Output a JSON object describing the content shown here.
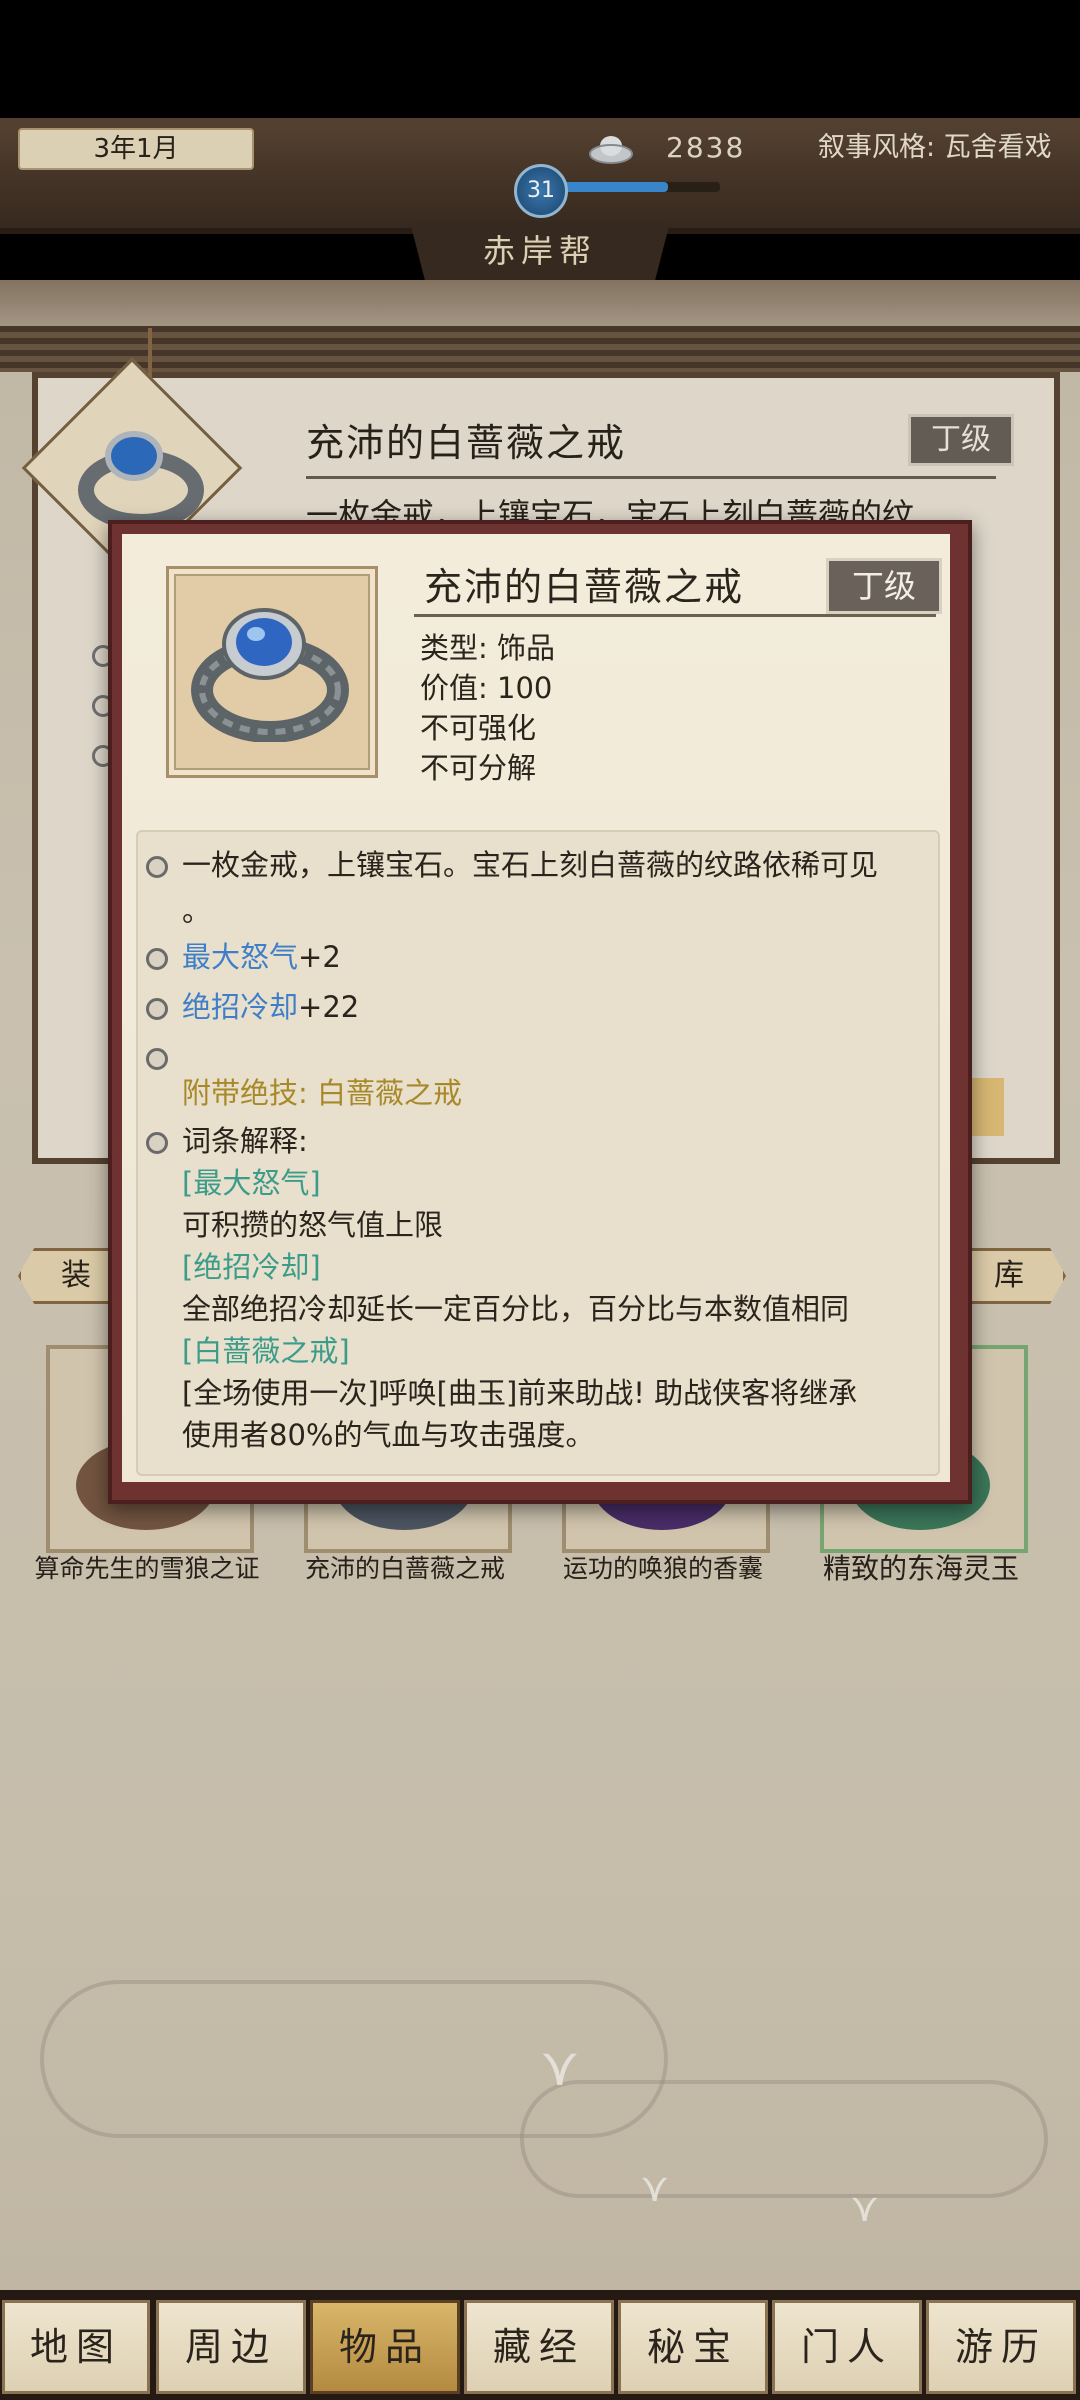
{
  "header": {
    "date": "3年1月",
    "money": "2838",
    "narrative_style": "叙事风格: 瓦舍看戏",
    "level": "31",
    "exp_fraction": 0.71,
    "sect_name": "赤岸帮"
  },
  "background_detail": {
    "title": "充沛的白蔷薇之戒",
    "grade": "丁级",
    "desc_partial": "一枚金戒，上镶宝石，宝石上刻白蔷薇的纹",
    "tab_left": "装",
    "tab_right": "库"
  },
  "items": [
    {
      "name": "算命先生的雪狼之证"
    },
    {
      "name": "充沛的白蔷薇之戒"
    },
    {
      "name": "运功的唤狼的香囊"
    },
    {
      "name": "精致的东海灵玉"
    }
  ],
  "modal": {
    "title": "充沛的白蔷薇之戒",
    "grade": "丁级",
    "type_line": "类型: 饰品",
    "value_line": "价值: 100",
    "enhance_line": "不可强化",
    "decompose_line": "不可分解",
    "description": "一枚金戒，上镶宝石。宝石上刻白蔷薇的纹路依稀可见",
    "description_tail": "。",
    "stat1_name": "最大怒气",
    "stat1_value": "+2",
    "stat2_name": "绝招冷却",
    "stat2_value": "+22",
    "skill_line": "附带绝技: 白蔷薇之戒",
    "terms_title": "词条解释:",
    "term1_name": "[最大怒气]",
    "term1_desc": "可积攒的怒气值上限",
    "term2_name": "[绝招冷却]",
    "term2_desc": "全部绝招冷却延长一定百分比，百分比与本数值相同",
    "term3_name": "[白蔷薇之戒]",
    "term3_desc_line1": "[全场使用一次]呼唤[曲玉]前来助战! 助战侠客将继承",
    "term3_desc_line2": "使用者80%的气血与攻击强度。"
  },
  "bottom_nav": [
    {
      "label": "地图"
    },
    {
      "label": "周边"
    },
    {
      "label": "物品",
      "active": true
    },
    {
      "label": "藏经"
    },
    {
      "label": "秘宝"
    },
    {
      "label": "门人"
    },
    {
      "label": "游历"
    }
  ],
  "colors": {
    "stat_blue": "#3f7fc8",
    "skill_gold": "#a8892a",
    "term_teal": "#3c9c8a",
    "modal_border": "#6e3331",
    "grade_badge": "#6a625a",
    "active_tab": "#c9a052"
  }
}
